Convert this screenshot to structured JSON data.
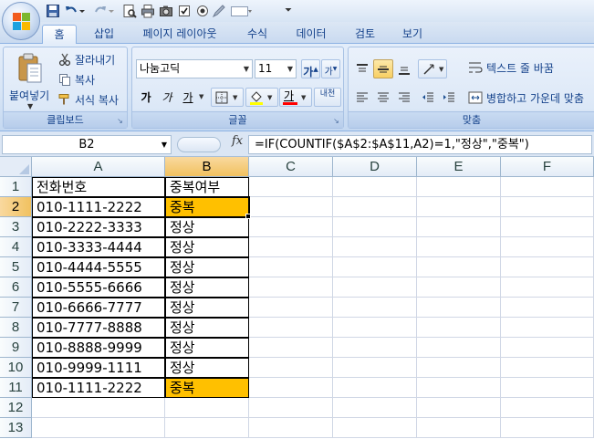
{
  "ribbon": {
    "tabs": [
      "홈",
      "삽입",
      "페이지 레이아웃",
      "수식",
      "데이터",
      "검토",
      "보기"
    ],
    "active_tab": "홈",
    "clipboard": {
      "paste_label": "붙여넣기",
      "cut_label": "잘라내기",
      "copy_label": "복사",
      "format_painter_label": "서식 복사",
      "group_label": "클립보드"
    },
    "font": {
      "font_name": "나눔고딕",
      "font_size": "11",
      "grow_label": "가",
      "shrink_label": "가",
      "bold_label": "가",
      "italic_label": "가",
      "underline_label": "가",
      "font_color_label": "가",
      "phonetic_label": "내천",
      "group_label": "글꼴"
    },
    "alignment": {
      "wrap_text_label": "텍스트 줄 바꿈",
      "merge_center_label": "병합하고 가운데 맞춤",
      "group_label": "맞춤"
    }
  },
  "formula_bar": {
    "name_box": "B2",
    "fx_label": "fx",
    "formula": "=IF(COUNTIF($A$2:$A$11,A2)=1,\"정상\",\"중복\")"
  },
  "sheet": {
    "columns": [
      "A",
      "B",
      "C",
      "D",
      "E",
      "F"
    ],
    "rows": [
      {
        "num": "1",
        "a": "전화번호",
        "b": "중복여부",
        "dup": false
      },
      {
        "num": "2",
        "a": "010-1111-2222",
        "b": "중복",
        "dup": true
      },
      {
        "num": "3",
        "a": "010-2222-3333",
        "b": "정상",
        "dup": false
      },
      {
        "num": "4",
        "a": "010-3333-4444",
        "b": "정상",
        "dup": false
      },
      {
        "num": "5",
        "a": "010-4444-5555",
        "b": "정상",
        "dup": false
      },
      {
        "num": "6",
        "a": "010-5555-6666",
        "b": "정상",
        "dup": false
      },
      {
        "num": "7",
        "a": "010-6666-7777",
        "b": "정상",
        "dup": false
      },
      {
        "num": "8",
        "a": "010-7777-8888",
        "b": "정상",
        "dup": false
      },
      {
        "num": "9",
        "a": "010-8888-9999",
        "b": "정상",
        "dup": false
      },
      {
        "num": "10",
        "a": "010-9999-1111",
        "b": "정상",
        "dup": false
      },
      {
        "num": "11",
        "a": "010-1111-2222",
        "b": "중복",
        "dup": true
      },
      {
        "num": "12",
        "a": "",
        "b": "",
        "dup": false
      },
      {
        "num": "13",
        "a": "",
        "b": "",
        "dup": false
      }
    ],
    "selected_column": "B",
    "selected_row": "2",
    "highlight_color": "#ffc000"
  },
  "icons": {
    "office_button": "office-logo-icon",
    "quick_access": [
      "save-icon",
      "undo-icon",
      "redo-icon",
      "print-preview-icon",
      "print-icon",
      "camera-icon",
      "checkbox-icon",
      "radio-icon",
      "edit-shape-icon",
      "form-control-icon",
      "customize-qat-icon"
    ]
  }
}
